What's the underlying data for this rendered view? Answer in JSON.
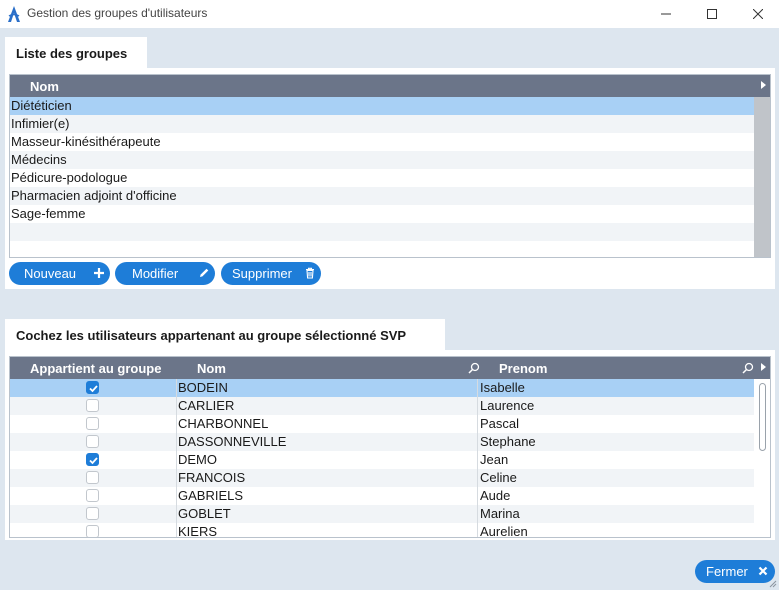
{
  "window": {
    "title": "Gestion des groupes d'utilisateurs"
  },
  "groups": {
    "tab_label": "Liste des groupes",
    "column": "Nom",
    "items": [
      "Diététicien",
      "Infimier(e)",
      "Masseur-kinésithérapeute",
      "Médecins",
      "Pédicure-podologue",
      "Pharmacien adjoint d'officine",
      "Sage-femme"
    ],
    "selected_index": 0,
    "buttons": {
      "new": "Nouveau",
      "edit": "Modifier",
      "delete": "Supprimer"
    }
  },
  "users": {
    "tab_label": "Cochez les utilisateurs appartenant au groupe sélectionné SVP",
    "columns": {
      "member": "Appartient au groupe",
      "last_name": "Nom",
      "first_name": "Prenom"
    },
    "rows": [
      {
        "checked": true,
        "last_name": "BODEIN",
        "first_name": "Isabelle"
      },
      {
        "checked": false,
        "last_name": "CARLIER",
        "first_name": "Laurence"
      },
      {
        "checked": false,
        "last_name": "CHARBONNEL",
        "first_name": "Pascal"
      },
      {
        "checked": false,
        "last_name": "DASSONNEVILLE",
        "first_name": "Stephane"
      },
      {
        "checked": true,
        "last_name": "DEMO",
        "first_name": "Jean"
      },
      {
        "checked": false,
        "last_name": "FRANCOIS",
        "first_name": "Celine"
      },
      {
        "checked": false,
        "last_name": "GABRIELS",
        "first_name": "Aude"
      },
      {
        "checked": false,
        "last_name": "GOBLET",
        "first_name": "Marina"
      },
      {
        "checked": false,
        "last_name": "KIERS",
        "first_name": "Aurelien"
      }
    ],
    "selected_index": 0
  },
  "footer": {
    "close_label": "Fermer"
  },
  "colors": {
    "accent": "#1e7dd8",
    "header": "#6b7589",
    "selection": "#a8d0f5",
    "background": "#dde6ef"
  }
}
